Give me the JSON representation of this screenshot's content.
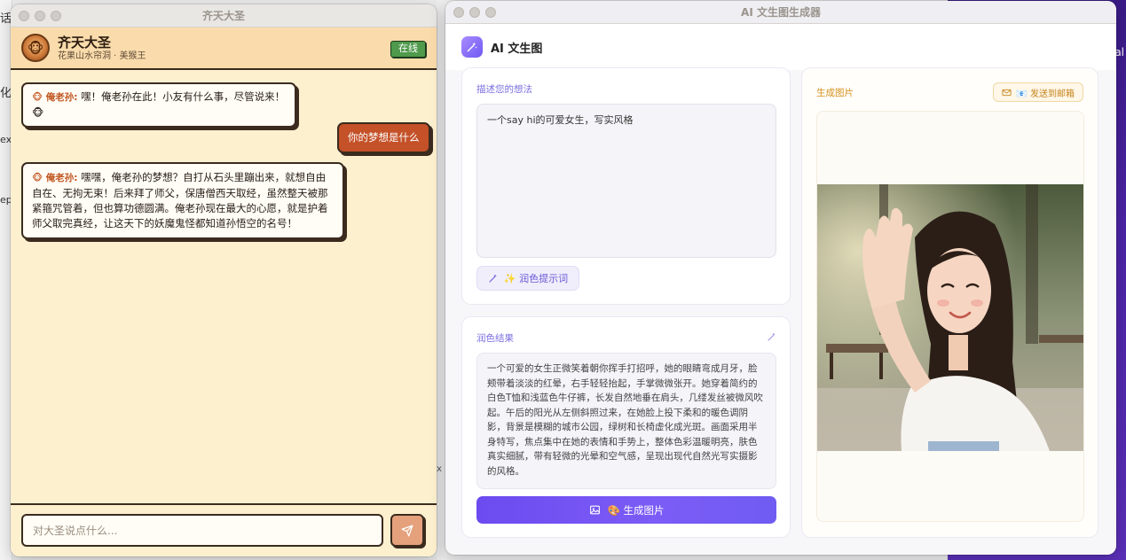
{
  "background": {
    "left_fragments": [
      "话",
      "化",
      "ex",
      "ep"
    ],
    "middle_fragment": "x",
    "right_fragment": "al"
  },
  "chat_window": {
    "title": "齐天大圣",
    "header": {
      "avatar_emoji": "🐵",
      "name": "齐天大圣",
      "subtitle": "花果山水帘洞 · 美猴王",
      "status": "在线"
    },
    "messages": [
      {
        "role": "ai",
        "speaker": "🐵 俺老孙:",
        "text": "嘿！俺老孙在此！小友有什么事，尽管说来！🐵"
      },
      {
        "role": "user",
        "text": "你的梦想是什么"
      },
      {
        "role": "ai",
        "speaker": "🐵 俺老孙:",
        "text": "嘿嘿，俺老孙的梦想？自打从石头里蹦出来，就想自由自在、无拘无束！后来拜了师父，保唐僧西天取经，虽然整天被那紧箍咒管着，但也算功德圆满。俺老孙现在最大的心愿，就是护着师父取完真经，让这天下的妖魔鬼怪都知道孙悟空的名号！"
      }
    ],
    "input_placeholder": "对大圣说点什么...",
    "input_value": ""
  },
  "ai_window": {
    "title": "AI 文生图生成器",
    "app_title": "AI 文生图",
    "prompt_card": {
      "label": "描述您的想法",
      "prompt_text": "一个say hi的可爱女生，写实风格",
      "polish_button": "✨ 润色提示词"
    },
    "result_card": {
      "label": "润色结果",
      "text": "一个可爱的女生正微笑着朝你挥手打招呼，她的眼睛弯成月牙，脸颊带着淡淡的红晕，右手轻轻抬起，手掌微微张开。她穿着简约的白色T恤和浅蓝色牛仔裤，长发自然地垂在肩头，几缕发丝被微风吹起。午后的阳光从左侧斜照过来，在她脸上投下柔和的暖色调阴影，背景是模糊的城市公园，绿树和长椅虚化成光斑。画面采用半身特写，焦点集中在她的表情和手势上，整体色彩温暖明亮，肤色真实细腻，带有轻微的光晕和空气感，呈现出现代自然光写实摄影的风格。",
      "generate_button": "🎨 生成图片"
    },
    "image_card": {
      "label": "生成图片",
      "email_button": "📧 发送到邮箱",
      "image_description": "generated-photo"
    }
  },
  "colors": {
    "chat_bg": "#fdf0cf",
    "chat_header": "#fadcac",
    "user_bubble": "#c45128",
    "online_green": "#4f9a4c",
    "accent_purple": "#6c4bf0",
    "gold": "#d5901d"
  }
}
